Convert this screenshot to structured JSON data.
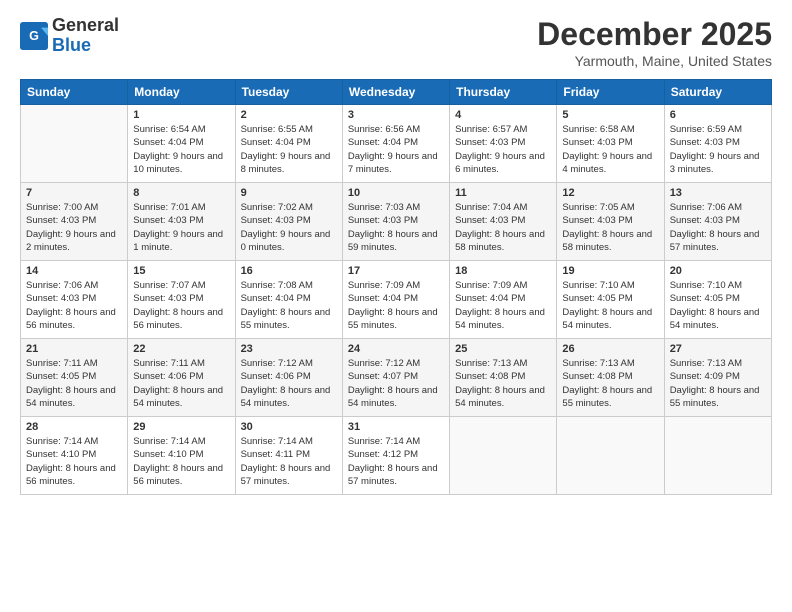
{
  "logo": {
    "general": "General",
    "blue": "Blue"
  },
  "header": {
    "month": "December 2025",
    "location": "Yarmouth, Maine, United States"
  },
  "days_of_week": [
    "Sunday",
    "Monday",
    "Tuesday",
    "Wednesday",
    "Thursday",
    "Friday",
    "Saturday"
  ],
  "weeks": [
    [
      {
        "day": "",
        "sunrise": "",
        "sunset": "",
        "daylight": ""
      },
      {
        "day": "1",
        "sunrise": "Sunrise: 6:54 AM",
        "sunset": "Sunset: 4:04 PM",
        "daylight": "Daylight: 9 hours and 10 minutes."
      },
      {
        "day": "2",
        "sunrise": "Sunrise: 6:55 AM",
        "sunset": "Sunset: 4:04 PM",
        "daylight": "Daylight: 9 hours and 8 minutes."
      },
      {
        "day": "3",
        "sunrise": "Sunrise: 6:56 AM",
        "sunset": "Sunset: 4:04 PM",
        "daylight": "Daylight: 9 hours and 7 minutes."
      },
      {
        "day": "4",
        "sunrise": "Sunrise: 6:57 AM",
        "sunset": "Sunset: 4:03 PM",
        "daylight": "Daylight: 9 hours and 6 minutes."
      },
      {
        "day": "5",
        "sunrise": "Sunrise: 6:58 AM",
        "sunset": "Sunset: 4:03 PM",
        "daylight": "Daylight: 9 hours and 4 minutes."
      },
      {
        "day": "6",
        "sunrise": "Sunrise: 6:59 AM",
        "sunset": "Sunset: 4:03 PM",
        "daylight": "Daylight: 9 hours and 3 minutes."
      }
    ],
    [
      {
        "day": "7",
        "sunrise": "Sunrise: 7:00 AM",
        "sunset": "Sunset: 4:03 PM",
        "daylight": "Daylight: 9 hours and 2 minutes."
      },
      {
        "day": "8",
        "sunrise": "Sunrise: 7:01 AM",
        "sunset": "Sunset: 4:03 PM",
        "daylight": "Daylight: 9 hours and 1 minute."
      },
      {
        "day": "9",
        "sunrise": "Sunrise: 7:02 AM",
        "sunset": "Sunset: 4:03 PM",
        "daylight": "Daylight: 9 hours and 0 minutes."
      },
      {
        "day": "10",
        "sunrise": "Sunrise: 7:03 AM",
        "sunset": "Sunset: 4:03 PM",
        "daylight": "Daylight: 8 hours and 59 minutes."
      },
      {
        "day": "11",
        "sunrise": "Sunrise: 7:04 AM",
        "sunset": "Sunset: 4:03 PM",
        "daylight": "Daylight: 8 hours and 58 minutes."
      },
      {
        "day": "12",
        "sunrise": "Sunrise: 7:05 AM",
        "sunset": "Sunset: 4:03 PM",
        "daylight": "Daylight: 8 hours and 58 minutes."
      },
      {
        "day": "13",
        "sunrise": "Sunrise: 7:06 AM",
        "sunset": "Sunset: 4:03 PM",
        "daylight": "Daylight: 8 hours and 57 minutes."
      }
    ],
    [
      {
        "day": "14",
        "sunrise": "Sunrise: 7:06 AM",
        "sunset": "Sunset: 4:03 PM",
        "daylight": "Daylight: 8 hours and 56 minutes."
      },
      {
        "day": "15",
        "sunrise": "Sunrise: 7:07 AM",
        "sunset": "Sunset: 4:03 PM",
        "daylight": "Daylight: 8 hours and 56 minutes."
      },
      {
        "day": "16",
        "sunrise": "Sunrise: 7:08 AM",
        "sunset": "Sunset: 4:04 PM",
        "daylight": "Daylight: 8 hours and 55 minutes."
      },
      {
        "day": "17",
        "sunrise": "Sunrise: 7:09 AM",
        "sunset": "Sunset: 4:04 PM",
        "daylight": "Daylight: 8 hours and 55 minutes."
      },
      {
        "day": "18",
        "sunrise": "Sunrise: 7:09 AM",
        "sunset": "Sunset: 4:04 PM",
        "daylight": "Daylight: 8 hours and 54 minutes."
      },
      {
        "day": "19",
        "sunrise": "Sunrise: 7:10 AM",
        "sunset": "Sunset: 4:05 PM",
        "daylight": "Daylight: 8 hours and 54 minutes."
      },
      {
        "day": "20",
        "sunrise": "Sunrise: 7:10 AM",
        "sunset": "Sunset: 4:05 PM",
        "daylight": "Daylight: 8 hours and 54 minutes."
      }
    ],
    [
      {
        "day": "21",
        "sunrise": "Sunrise: 7:11 AM",
        "sunset": "Sunset: 4:05 PM",
        "daylight": "Daylight: 8 hours and 54 minutes."
      },
      {
        "day": "22",
        "sunrise": "Sunrise: 7:11 AM",
        "sunset": "Sunset: 4:06 PM",
        "daylight": "Daylight: 8 hours and 54 minutes."
      },
      {
        "day": "23",
        "sunrise": "Sunrise: 7:12 AM",
        "sunset": "Sunset: 4:06 PM",
        "daylight": "Daylight: 8 hours and 54 minutes."
      },
      {
        "day": "24",
        "sunrise": "Sunrise: 7:12 AM",
        "sunset": "Sunset: 4:07 PM",
        "daylight": "Daylight: 8 hours and 54 minutes."
      },
      {
        "day": "25",
        "sunrise": "Sunrise: 7:13 AM",
        "sunset": "Sunset: 4:08 PM",
        "daylight": "Daylight: 8 hours and 54 minutes."
      },
      {
        "day": "26",
        "sunrise": "Sunrise: 7:13 AM",
        "sunset": "Sunset: 4:08 PM",
        "daylight": "Daylight: 8 hours and 55 minutes."
      },
      {
        "day": "27",
        "sunrise": "Sunrise: 7:13 AM",
        "sunset": "Sunset: 4:09 PM",
        "daylight": "Daylight: 8 hours and 55 minutes."
      }
    ],
    [
      {
        "day": "28",
        "sunrise": "Sunrise: 7:14 AM",
        "sunset": "Sunset: 4:10 PM",
        "daylight": "Daylight: 8 hours and 56 minutes."
      },
      {
        "day": "29",
        "sunrise": "Sunrise: 7:14 AM",
        "sunset": "Sunset: 4:10 PM",
        "daylight": "Daylight: 8 hours and 56 minutes."
      },
      {
        "day": "30",
        "sunrise": "Sunrise: 7:14 AM",
        "sunset": "Sunset: 4:11 PM",
        "daylight": "Daylight: 8 hours and 57 minutes."
      },
      {
        "day": "31",
        "sunrise": "Sunrise: 7:14 AM",
        "sunset": "Sunset: 4:12 PM",
        "daylight": "Daylight: 8 hours and 57 minutes."
      },
      {
        "day": "",
        "sunrise": "",
        "sunset": "",
        "daylight": ""
      },
      {
        "day": "",
        "sunrise": "",
        "sunset": "",
        "daylight": ""
      },
      {
        "day": "",
        "sunrise": "",
        "sunset": "",
        "daylight": ""
      }
    ]
  ]
}
